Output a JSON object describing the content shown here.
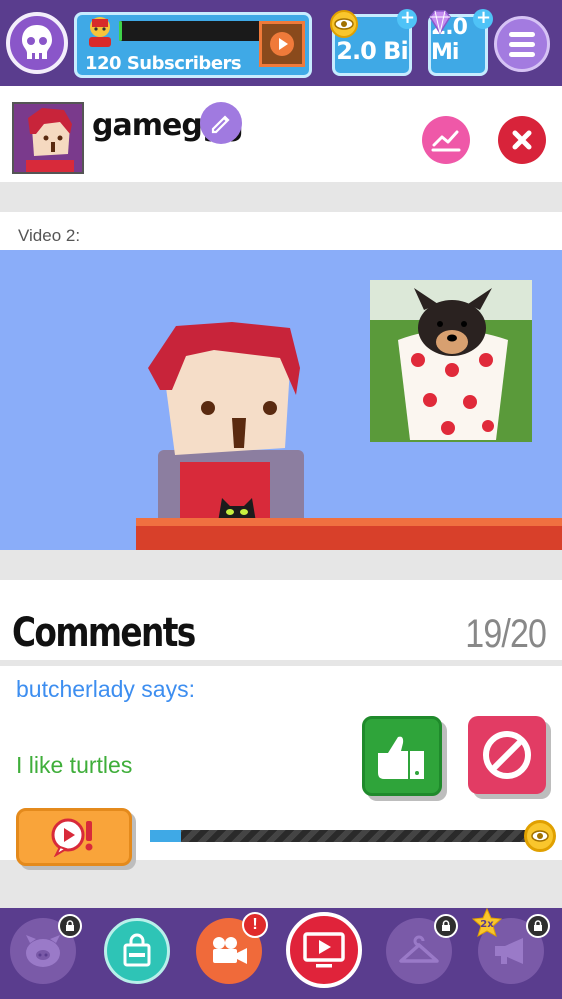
{
  "topbar": {
    "subscribers_text": "120 Subscribers",
    "subscriber_progress": 0.02,
    "views_value": "2.0 Bi",
    "gems_value": "2.0 Mi"
  },
  "profile": {
    "channel_name": "gameggg"
  },
  "video": {
    "label": "Video 2:"
  },
  "comments": {
    "title": "Comments",
    "count": "19/20",
    "commenter": "butcherlady says:",
    "text": "I like turtles"
  },
  "progress": {
    "fill": 0.08
  },
  "nav": {
    "items": [
      "pig-icon",
      "shopping-bag-icon",
      "camera-icon",
      "play-video-icon",
      "hanger-icon",
      "megaphone-icon"
    ],
    "badge_2x": "2x"
  },
  "colors": {
    "topbar": "#5a3d8e",
    "panel_blue": "#3fa9e6",
    "video_bg": "#8aadf9",
    "like_green": "#2fa43a",
    "block_red": "#e23c64",
    "commenter_blue": "#3d8ef0",
    "comment_green": "#3fae3a"
  }
}
